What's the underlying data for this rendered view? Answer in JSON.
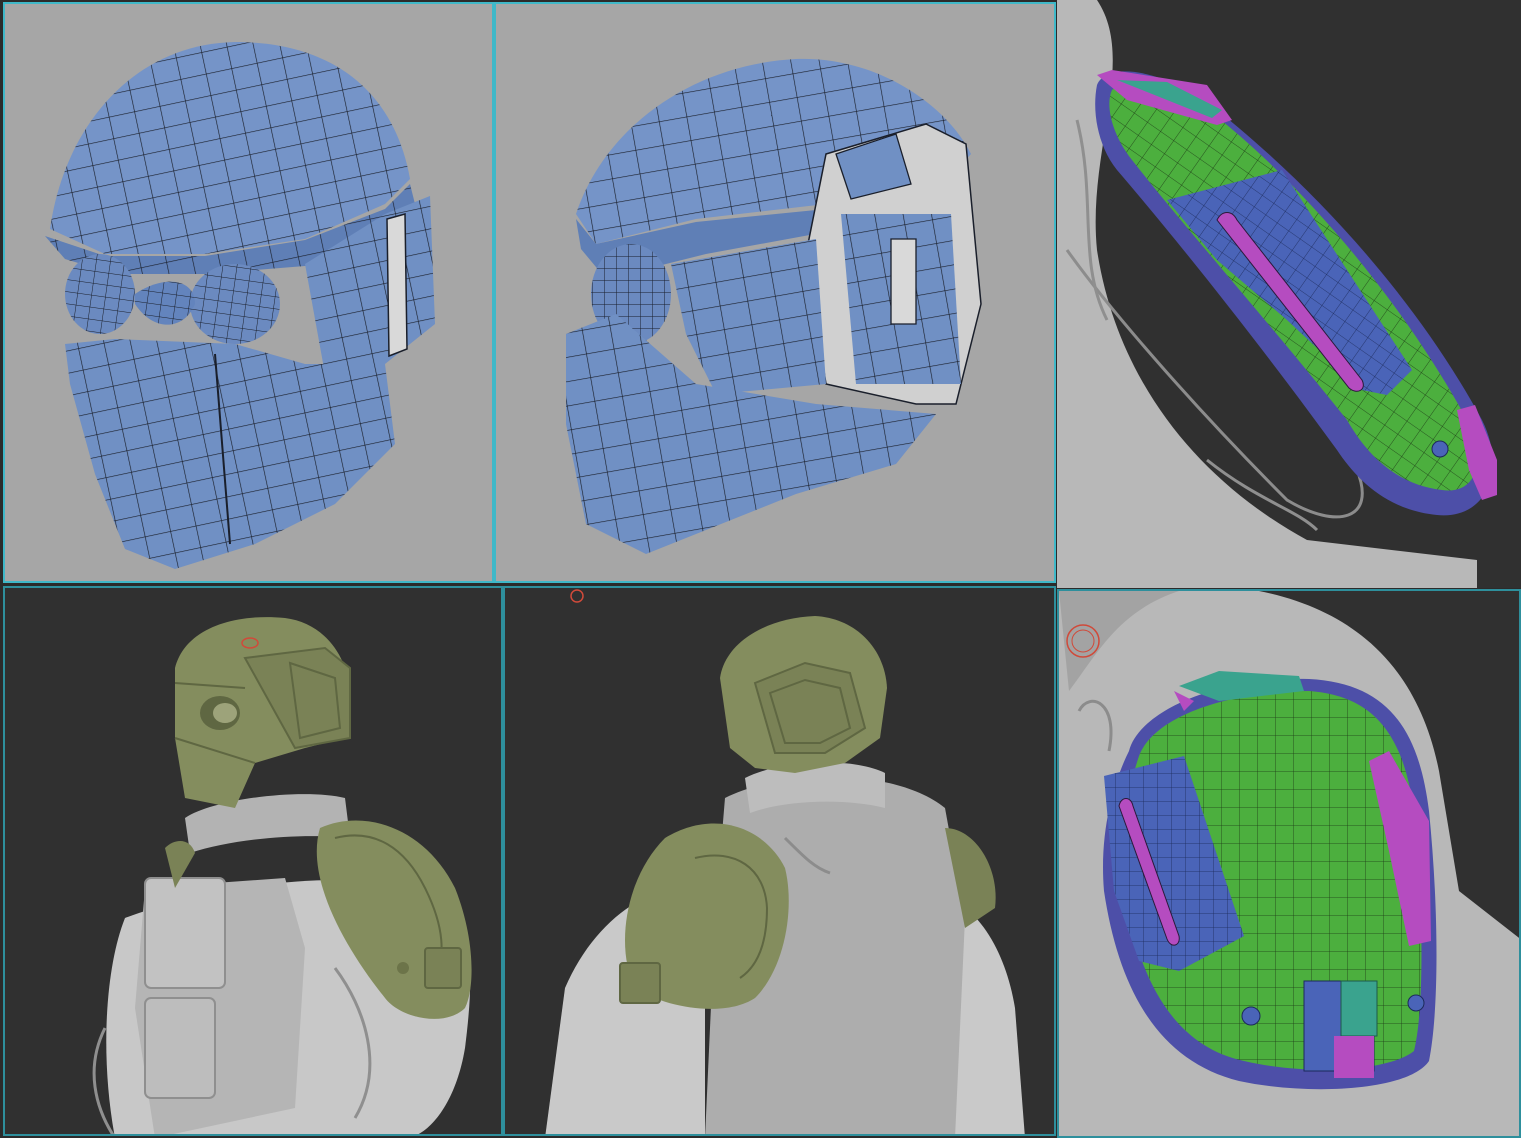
{
  "colors": {
    "viewport_gray": "#a6a6a6",
    "viewport_dark": "#303030",
    "frame_accent": "#3fb8c8",
    "mesh_blue": "#6f8fc4",
    "mesh_wire": "#1a1f2b",
    "armor_olive": "#848d5e",
    "clay_gray": "#b9b9b9",
    "polygroup_green": "#4caf3e",
    "polygroup_blue": "#4a64b8",
    "polygroup_magenta": "#b54cc0",
    "polygroup_teal": "#3aa38e"
  },
  "panels": [
    {
      "name": "helmet-lowpoly-front",
      "icon": "wireframe-helmet"
    },
    {
      "name": "helmet-lowpoly-side",
      "icon": "wireframe-helmet"
    },
    {
      "name": "shoulder-pad-polygroups-side",
      "icon": "polygroup-pad"
    },
    {
      "name": "character-armor-front",
      "icon": "sculpt-character"
    },
    {
      "name": "character-armor-back",
      "icon": "sculpt-character"
    },
    {
      "name": "shoulder-pad-polygroups-front",
      "icon": "polygroup-pad"
    }
  ]
}
